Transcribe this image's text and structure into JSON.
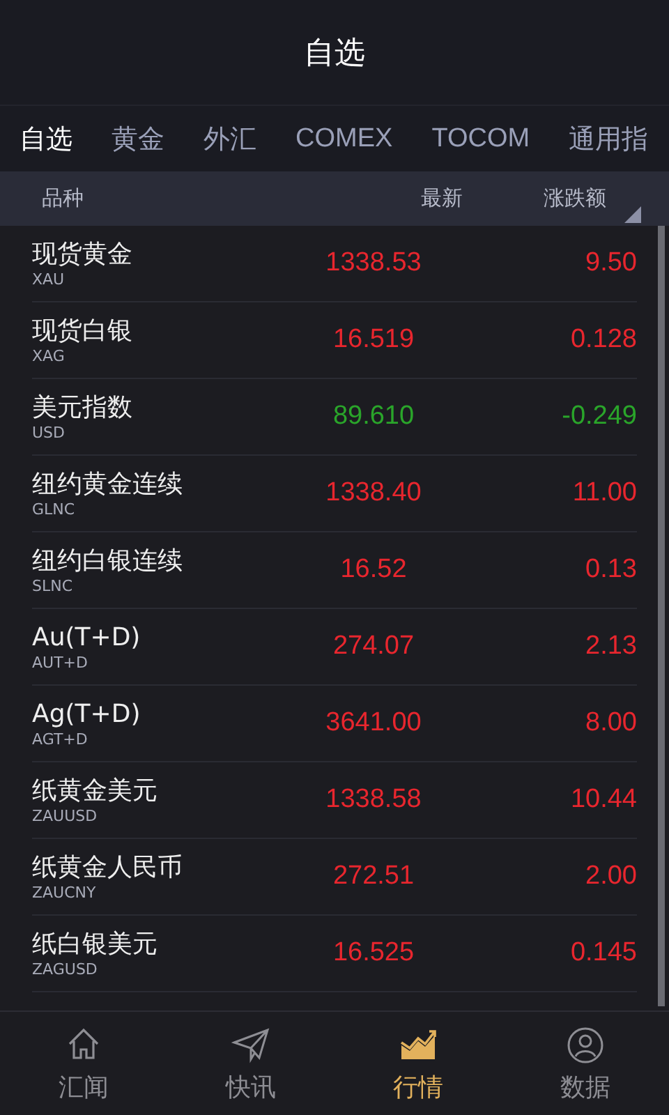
{
  "title": "自选",
  "tabs": [
    {
      "label": "自选",
      "selected": true
    },
    {
      "label": "黄金",
      "selected": false
    },
    {
      "label": "外汇",
      "selected": false
    },
    {
      "label": "COMEX",
      "selected": false
    },
    {
      "label": "TOCOM",
      "selected": false
    },
    {
      "label": "通用指",
      "selected": false
    }
  ],
  "table": {
    "columns": [
      "品种",
      "最新",
      "涨跌额"
    ],
    "rows": [
      {
        "name": "现货黄金",
        "code": "XAU",
        "price": "1338.53",
        "change": "9.50",
        "color": "#e8262e"
      },
      {
        "name": "现货白银",
        "code": "XAG",
        "price": "16.519",
        "change": "0.128",
        "color": "#e8262e"
      },
      {
        "name": "美元指数",
        "code": "USD",
        "price": "89.610",
        "change": "-0.249",
        "color": "#2aa52a"
      },
      {
        "name": "纽约黄金连续",
        "code": "GLNC",
        "price": "1338.40",
        "change": "11.00",
        "color": "#e8262e"
      },
      {
        "name": "纽约白银连续",
        "code": "SLNC",
        "price": "16.52",
        "change": "0.13",
        "color": "#e8262e"
      },
      {
        "name": "Au(T+D)",
        "code": "AUT+D",
        "price": "274.07",
        "change": "2.13",
        "color": "#e8262e"
      },
      {
        "name": "Ag(T+D)",
        "code": "AGT+D",
        "price": "3641.00",
        "change": "8.00",
        "color": "#e8262e"
      },
      {
        "name": "纸黄金美元",
        "code": "ZAUUSD",
        "price": "1338.58",
        "change": "10.44",
        "color": "#e8262e"
      },
      {
        "name": "纸黄金人民币",
        "code": "ZAUCNY",
        "price": "272.51",
        "change": "2.00",
        "color": "#e8262e"
      },
      {
        "name": "纸白银美元",
        "code": "ZAGUSD",
        "price": "16.525",
        "change": "0.145",
        "color": "#e8262e"
      }
    ]
  },
  "nav": [
    {
      "label": "汇闻",
      "kind": "home",
      "selected": false
    },
    {
      "label": "快讯",
      "kind": "plane",
      "selected": false
    },
    {
      "label": "行情",
      "kind": "chart",
      "selected": true
    },
    {
      "label": "数据",
      "kind": "user",
      "selected": false
    }
  ]
}
